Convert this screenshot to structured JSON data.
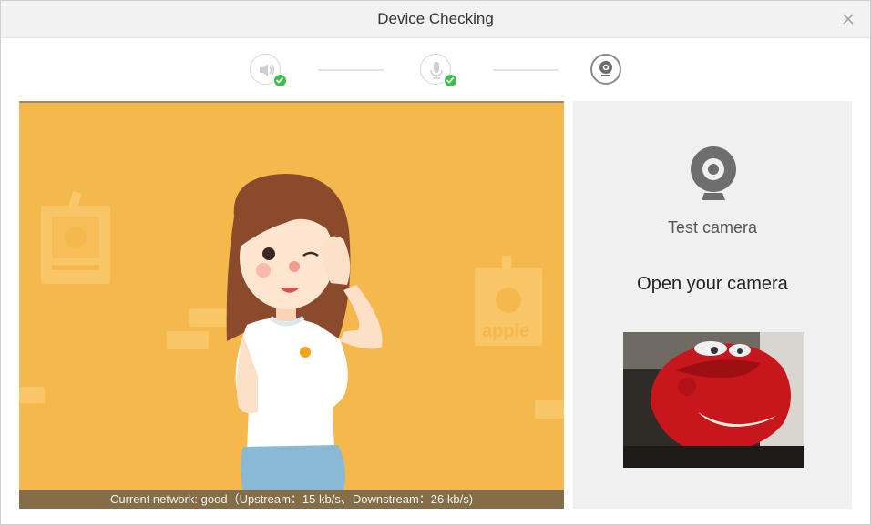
{
  "window": {
    "title": "Device Checking"
  },
  "stepper": {
    "steps": [
      {
        "icon": "speaker-icon",
        "state": "checked"
      },
      {
        "icon": "microphone-icon",
        "state": "checked"
      },
      {
        "icon": "camera-icon",
        "state": "active"
      }
    ]
  },
  "preview": {
    "status_text": "Current network: good（Upstream：15 kb/s、Downstream：26 kb/s)",
    "decor_text": "apple"
  },
  "side_panel": {
    "test_label": "Test camera",
    "open_label": "Open your camera"
  },
  "colors": {
    "accent_green": "#3bbf4a",
    "preview_bg": "#f5b84c",
    "panel_bg": "#f0f0f0"
  }
}
